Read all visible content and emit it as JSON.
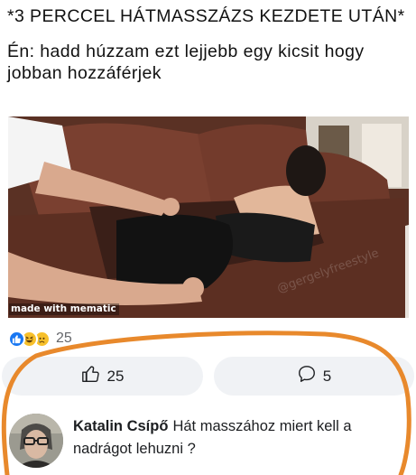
{
  "caption": {
    "line1": "*3 PERCCEL HÁTMASSZÁZS KEZDETE UTÁN*",
    "line2": "Én: hadd húzzam ezt lejjebb egy kicsit hogy jobban hozzáférjek"
  },
  "meme": {
    "watermark": "made with mematic",
    "faint_mark": "@gergelyfreestyle"
  },
  "reactions": {
    "icons": [
      "like-icon",
      "haha-icon",
      "sad-icon"
    ],
    "count": "25"
  },
  "actions": {
    "like_count": "25",
    "comment_count": "5"
  },
  "comment": {
    "author": "Katalin Csípő",
    "text": "Hát masszához miert kell a nadrágot lehuzni ?"
  },
  "colors": {
    "like_blue": "#1877f2",
    "emoji_yellow": "#f7c02b",
    "pill_bg": "#f0f2f5",
    "highlight_orange": "#e8892c"
  }
}
